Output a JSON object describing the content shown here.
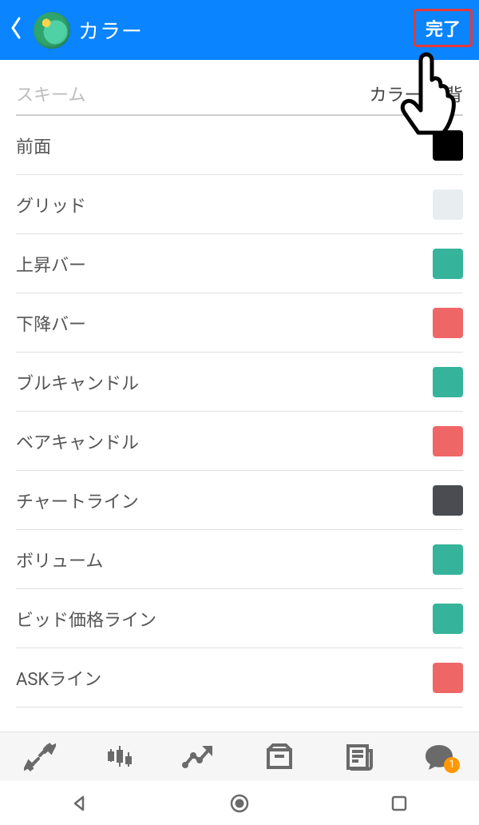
{
  "header": {
    "title": "カラー",
    "done_label": "完了"
  },
  "scheme": {
    "label": "スキーム",
    "value": "カラー(白背"
  },
  "rows": [
    {
      "label": "前面",
      "color": "#000000",
      "key": "foreground"
    },
    {
      "label": "グリッド",
      "color": "#e8eef0",
      "key": "grid"
    },
    {
      "label": "上昇バー",
      "color": "#35b49b",
      "key": "bar-up"
    },
    {
      "label": "下降バー",
      "color": "#ee6766",
      "key": "bar-down"
    },
    {
      "label": "ブルキャンドル",
      "color": "#35b49b",
      "key": "bull-candle"
    },
    {
      "label": "ベアキャンドル",
      "color": "#ee6766",
      "key": "bear-candle"
    },
    {
      "label": "チャートライン",
      "color": "#4a4c52",
      "key": "chart-line"
    },
    {
      "label": "ボリューム",
      "color": "#35b49b",
      "key": "volume"
    },
    {
      "label": "ビッド価格ライン",
      "color": "#35b49b",
      "key": "bid-line"
    },
    {
      "label": "ASKライン",
      "color": "#ee6766",
      "key": "ask-line"
    }
  ],
  "chat_badge": "1"
}
